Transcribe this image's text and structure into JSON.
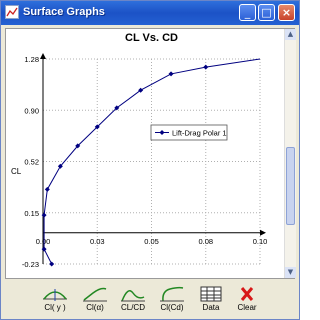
{
  "window": {
    "title": "Surface Graphs",
    "minimize_glyph": "_",
    "maximize_glyph": "□",
    "close_glyph": "×"
  },
  "chart_data": {
    "type": "line",
    "title": "CL Vs. CD",
    "xlabel": "",
    "ylabel": "CL",
    "xlim": [
      0.0,
      0.1
    ],
    "ylim": [
      -0.23,
      1.28
    ],
    "x_ticks": [
      "0.00",
      "0.03",
      "0.05",
      "0.08",
      "0.10"
    ],
    "y_ticks": [
      "-0.23",
      "0.15",
      "0.52",
      "0.90",
      "1.28"
    ],
    "grid": true,
    "legend_position": "center-right",
    "series": [
      {
        "name": "Lift-Drag Polar 1",
        "color": "#000080",
        "x": [
          0.004,
          0.0005,
          0.0005,
          0.002,
          0.008,
          0.016,
          0.025,
          0.034,
          0.045,
          0.059,
          0.075,
          0.1
        ],
        "y": [
          -0.23,
          -0.12,
          0.13,
          0.32,
          0.49,
          0.64,
          0.78,
          0.92,
          1.05,
          1.17,
          1.22,
          1.28
        ],
        "markers": [
          true,
          true,
          true,
          true,
          true,
          true,
          true,
          true,
          true,
          true,
          true,
          false
        ]
      }
    ]
  },
  "toolbar": {
    "buttons": [
      {
        "label": "Cl( y )"
      },
      {
        "label": "Cl(α)"
      },
      {
        "label": "CL/CD"
      },
      {
        "label": "Cl(Cd)"
      },
      {
        "label": "Data"
      },
      {
        "label": "Clear"
      }
    ]
  }
}
